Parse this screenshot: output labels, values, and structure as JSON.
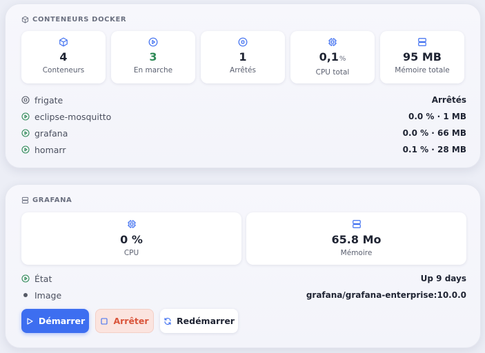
{
  "colors": {
    "accent": "#3d6ef0",
    "running": "#2f8a57",
    "stop": "#d9543a",
    "muted": "#6b7080"
  },
  "docker": {
    "header": "Conteneurs Docker",
    "header_icon": "box-icon",
    "stats": [
      {
        "icon": "box-icon",
        "value": "4",
        "label": "Conteneurs"
      },
      {
        "icon": "play-circle-icon",
        "value": "3",
        "label": "En marche"
      },
      {
        "icon": "stop-circle-icon",
        "value": "1",
        "label": "Arrêtés"
      },
      {
        "icon": "cpu-icon",
        "value": "0,1",
        "unit": "%",
        "label": "CPU total"
      },
      {
        "icon": "server-icon",
        "value": "95 MB",
        "label": "Mémoire totale"
      }
    ],
    "containers": [
      {
        "name": "frigate",
        "status": "stopped",
        "detail": "Arrêtés"
      },
      {
        "name": "eclipse-mosquitto",
        "status": "running",
        "detail": "0.0 % · 1 MB"
      },
      {
        "name": "grafana",
        "status": "running",
        "detail": "0.0 % · 66 MB"
      },
      {
        "name": "homarr",
        "status": "running",
        "detail": "0.1 % · 28 MB"
      }
    ]
  },
  "grafana": {
    "header": "Grafana",
    "header_icon": "server-icon",
    "cpu": {
      "icon": "cpu-icon",
      "value": "0 %",
      "label": "CPU"
    },
    "memory": {
      "icon": "server-icon",
      "value": "65.8 Mo",
      "label": "Mémoire"
    },
    "state_label": "État",
    "state_value": "Up 9 days",
    "image_label": "Image",
    "image_value": "grafana/grafana-enterprise:10.0.0",
    "buttons": {
      "start": "Démarrer",
      "stop": "Arrêter",
      "restart": "Redémarrer"
    }
  }
}
